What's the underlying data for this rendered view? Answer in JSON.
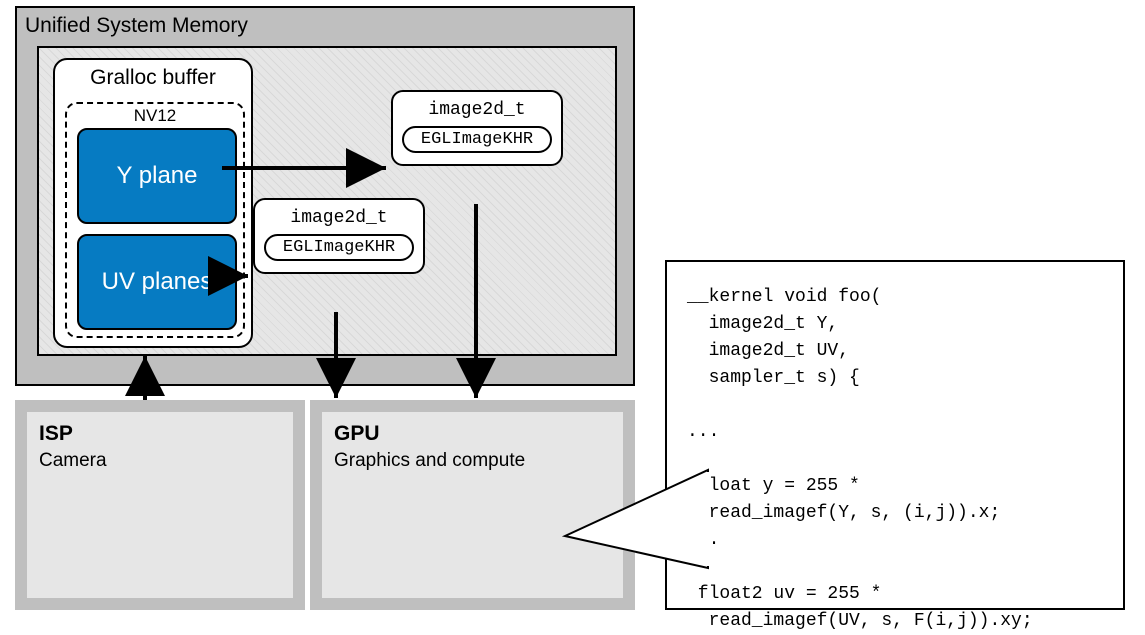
{
  "usm": {
    "title": "Unified System Memory"
  },
  "gralloc": {
    "label": "Gralloc buffer",
    "format": "NV12",
    "y_label": "Y plane",
    "uv_label": "UV planes"
  },
  "image2d": {
    "type_label": "image2d_t",
    "egl_label": "EGLImageKHR"
  },
  "isp": {
    "title": "ISP",
    "subtitle": "Camera"
  },
  "gpu": {
    "title": "GPU",
    "subtitle": "Graphics and compute"
  },
  "code": {
    "line1": "__kernel void foo(",
    "line2": "  image2d_t Y,",
    "line3": "  image2d_t UV,",
    "line4": "  sampler_t s) {",
    "blank": "",
    "dots": "...",
    "line5": " float y = 255 *",
    "line6": "  read_imagef(Y, s, (i,j)).x;",
    "line7": " float2 uv = 255 *",
    "line8": "  read_imagef(UV, s, F(i,j)).xy;"
  }
}
